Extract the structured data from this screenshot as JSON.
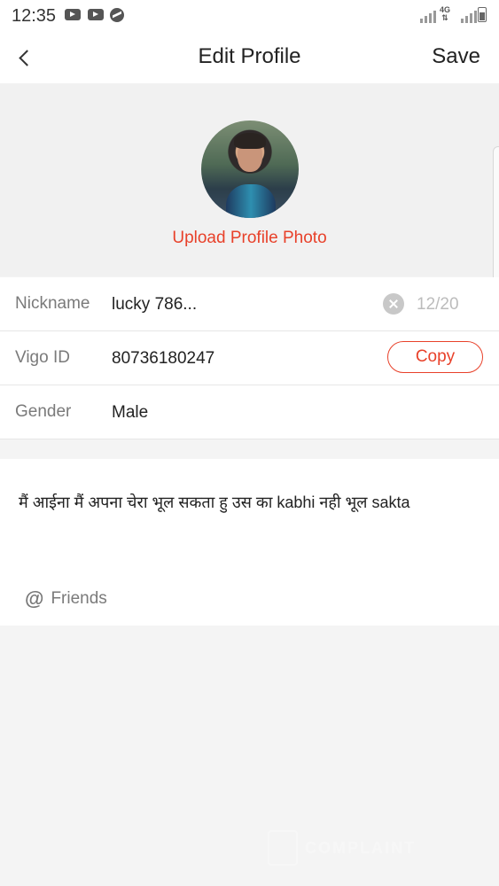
{
  "status_bar": {
    "time": "12:35",
    "network": "4G",
    "icons": [
      "youtube-icon",
      "youtube-icon",
      "messenger-icon",
      "signal-icon",
      "network-4g-icon",
      "signal-icon",
      "battery-icon"
    ]
  },
  "header": {
    "title": "Edit Profile",
    "save_label": "Save",
    "back_icon": "chevron-left-icon"
  },
  "profile_photo": {
    "upload_label": "Upload Profile Photo"
  },
  "fields": {
    "nickname": {
      "label": "Nickname",
      "value": "lucky 786...",
      "count": "12/20"
    },
    "vigo_id": {
      "label": "Vigo ID",
      "value": "80736180247",
      "copy_label": "Copy"
    },
    "gender": {
      "label": "Gender",
      "value": "Male"
    }
  },
  "bio": {
    "text": "मैं आईना मैं अपना चेरा भूल सकता हु उस का kabhi नही भूल sakta",
    "mention_label": "Friends",
    "mention_icon": "at-sign-icon"
  },
  "colors": {
    "accent": "#e8412a",
    "background": "#f4f4f4"
  }
}
